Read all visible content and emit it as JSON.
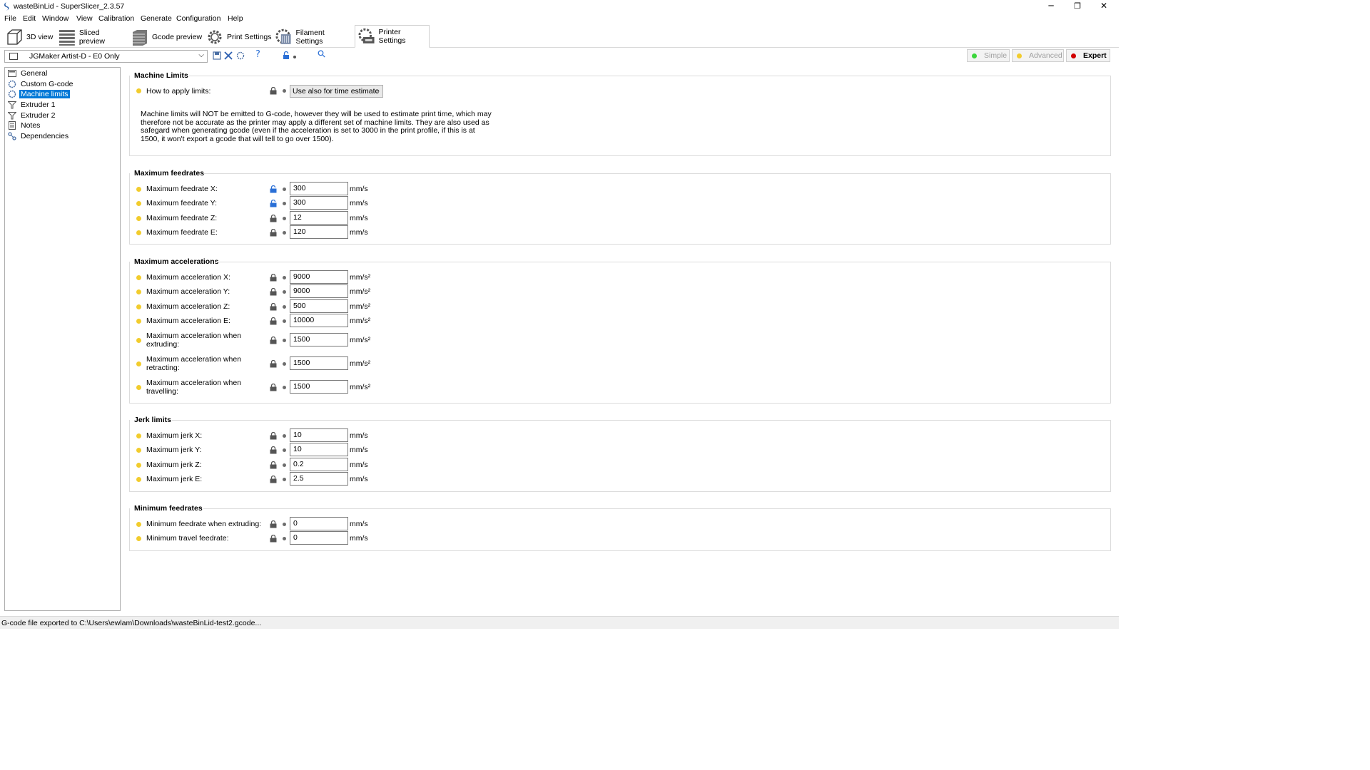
{
  "window": {
    "title": "wasteBinLid - SuperSlicer_2.3.57",
    "controls": {
      "minimize": "─",
      "maximize": "❐",
      "close": "✕"
    }
  },
  "menu": [
    "File",
    "Edit",
    "Window",
    "View",
    "Calibration",
    "Generate",
    "Configuration",
    "Help"
  ],
  "tabs": [
    {
      "label": "3D view",
      "icon": "cube-icon"
    },
    {
      "label": "Sliced preview",
      "icon": "layers-icon"
    },
    {
      "label": "Gcode preview",
      "icon": "gcode-layers-icon"
    },
    {
      "label": "Print Settings",
      "icon": "gear-icon"
    },
    {
      "label": "Filament Settings",
      "icon": "filament-spool-icon"
    },
    {
      "label": "Printer Settings",
      "icon": "printer-gear-icon",
      "active": true
    }
  ],
  "preset": {
    "selected": "JGMaker Artist-D - E0 Only",
    "icons": [
      "save-icon",
      "delete-icon",
      "compare-icon",
      "help-icon",
      "lock-icon",
      "search-icon"
    ],
    "help_glyph": "?",
    "search_glyph": "⚲"
  },
  "modes": {
    "simple": "Simple",
    "advanced": "Advanced",
    "expert": "Expert",
    "colors": {
      "simple": "#3bd63b",
      "advanced": "#f2cc2d",
      "expert": "#d10000"
    }
  },
  "sidebar": {
    "items": [
      {
        "label": "General",
        "icon": "general-icon"
      },
      {
        "label": "Custom G-code",
        "icon": "gear-icon"
      },
      {
        "label": "Machine limits",
        "icon": "gear-icon",
        "selected": true
      },
      {
        "label": "Extruder 1",
        "icon": "funnel-icon"
      },
      {
        "label": "Extruder 2",
        "icon": "funnel-icon"
      },
      {
        "label": "Notes",
        "icon": "notes-icon"
      },
      {
        "label": "Dependencies",
        "icon": "dependencies-icon"
      }
    ]
  },
  "machine_limits": {
    "title": "Machine Limits",
    "apply_label": "How to apply limits:",
    "apply_value": "Use also for time estimate",
    "notice": "Machine limits will NOT be emitted to G-code, however they will be used to estimate print time, which may therefore not be accurate as the printer may apply a different set of machine limits. They are also used as safegard when generating gcode (even if the acceleration is set to 3000 in the print profile, if this is at 1500, it won't export a gcode that will tell to go over 1500)."
  },
  "feedrates": {
    "title": "Maximum feedrates",
    "rows": [
      {
        "label": "Maximum feedrate X:",
        "value": "300",
        "unit": "mm/s",
        "lock": "unlocked"
      },
      {
        "label": "Maximum feedrate Y:",
        "value": "300",
        "unit": "mm/s",
        "lock": "unlocked"
      },
      {
        "label": "Maximum feedrate Z:",
        "value": "12",
        "unit": "mm/s",
        "lock": "locked"
      },
      {
        "label": "Maximum feedrate E:",
        "value": "120",
        "unit": "mm/s",
        "lock": "locked"
      }
    ]
  },
  "accelerations": {
    "title": "Maximum accelerations",
    "rows": [
      {
        "label": "Maximum acceleration X:",
        "value": "9000",
        "unit": "mm/s²"
      },
      {
        "label": "Maximum acceleration Y:",
        "value": "9000",
        "unit": "mm/s²"
      },
      {
        "label": "Maximum acceleration Z:",
        "value": "500",
        "unit": "mm/s²"
      },
      {
        "label": "Maximum acceleration E:",
        "value": "10000",
        "unit": "mm/s²"
      },
      {
        "label": "Maximum acceleration when\nextruding:",
        "value": "1500",
        "unit": "mm/s²"
      },
      {
        "label": "Maximum acceleration when\nretracting:",
        "value": "1500",
        "unit": "mm/s²"
      },
      {
        "label": "Maximum acceleration when\ntravelling:",
        "value": "1500",
        "unit": "mm/s²"
      }
    ]
  },
  "jerk": {
    "title": "Jerk limits",
    "rows": [
      {
        "label": "Maximum jerk X:",
        "value": "10",
        "unit": "mm/s"
      },
      {
        "label": "Maximum jerk Y:",
        "value": "10",
        "unit": "mm/s"
      },
      {
        "label": "Maximum jerk Z:",
        "value": "0.2",
        "unit": "mm/s"
      },
      {
        "label": "Maximum jerk E:",
        "value": "2.5",
        "unit": "mm/s"
      }
    ]
  },
  "min_feedrates": {
    "title": "Minimum feedrates",
    "rows": [
      {
        "label": "Minimum feedrate when extruding:",
        "value": "0",
        "unit": "mm/s"
      },
      {
        "label": "Minimum travel feedrate:",
        "value": "0",
        "unit": "mm/s"
      }
    ]
  },
  "status": "G-code file exported to C:\\Users\\ewlam\\Downloads\\wasteBinLid-test2.gcode...",
  "colors": {
    "bullet": "#f2cc2d",
    "selection": "#0078d7",
    "lock_unlocked": "#2a6fd6",
    "lock_locked": "#555555"
  }
}
